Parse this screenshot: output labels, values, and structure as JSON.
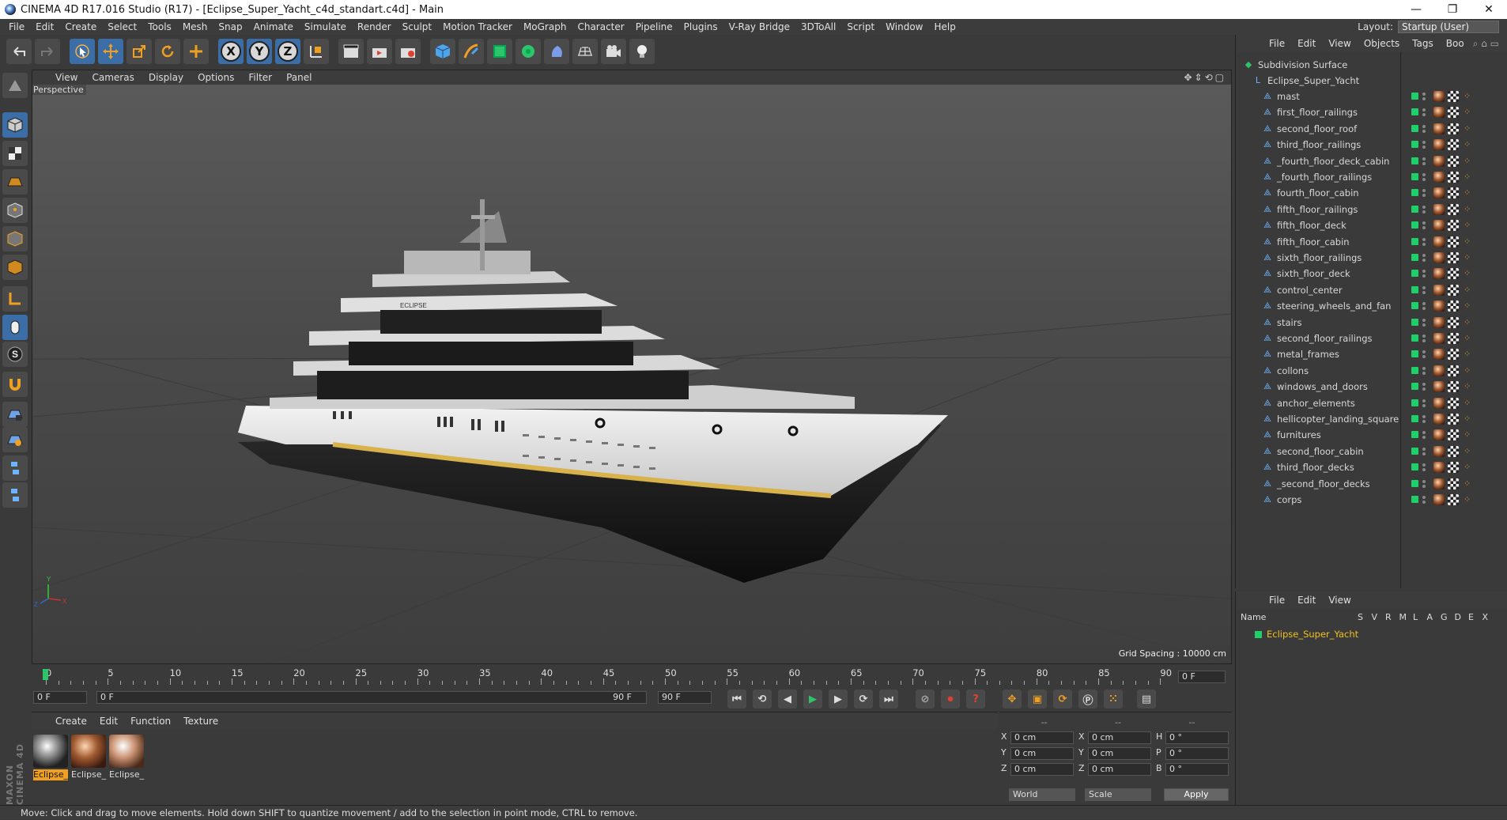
{
  "window": {
    "title": "CINEMA 4D R17.016 Studio (R17) - [Eclipse_Super_Yacht_c4d_standart.c4d] - Main",
    "minimize": "—",
    "restore": "❐",
    "close": "✕"
  },
  "menu": [
    "File",
    "Edit",
    "Create",
    "Select",
    "Tools",
    "Mesh",
    "Snap",
    "Animate",
    "Simulate",
    "Render",
    "Sculpt",
    "Motion Tracker",
    "MoGraph",
    "Character",
    "Pipeline",
    "Plugins",
    "V-Ray Bridge",
    "3DToAll",
    "Script",
    "Window",
    "Help"
  ],
  "layout": {
    "label": "Layout:",
    "value": "Startup (User)"
  },
  "toolbar": {
    "x_axis": "X",
    "y_axis": "Y",
    "z_axis": "Z"
  },
  "viewport": {
    "menu": [
      "View",
      "Cameras",
      "Display",
      "Options",
      "Filter",
      "Panel"
    ],
    "label": "Perspective",
    "grid_spacing": "Grid Spacing : 10000 cm",
    "yacht_name": "ECLIPSE",
    "axis_x": "X",
    "axis_y": "Y",
    "axis_z": "Z"
  },
  "timeline": {
    "ticks": [
      "0",
      "5",
      "10",
      "15",
      "20",
      "25",
      "30",
      "35",
      "40",
      "45",
      "50",
      "55",
      "60",
      "65",
      "70",
      "75",
      "80",
      "85",
      "90"
    ],
    "current_frame": "0 F",
    "start_field": "0 F",
    "range_start": "0 F",
    "range_end": "90 F",
    "end_field": "90 F",
    "frame_display": "0 F"
  },
  "objects_panel": {
    "menu": [
      "File",
      "Edit",
      "View",
      "Objects",
      "Tags",
      "Boo"
    ],
    "root": "Subdivision Surface",
    "group": "Eclipse_Super_Yacht",
    "items": [
      "mast",
      "first_floor_railings",
      "second_floor_roof",
      "third_floor_railings",
      "_fourth_floor_deck_cabin",
      "_fourth_floor_railings",
      "fourth_floor_cabin",
      "fifth_floor_railings",
      "fifth_floor_deck",
      "fifth_floor_cabin",
      "sixth_floor_railings",
      "sixth_floor_deck",
      "control_center",
      "steering_wheels_and_fan",
      "stairs",
      "second_floor_railings",
      "metal_frames",
      "collons",
      "windows_and_doors",
      "anchor_elements",
      "hellicopter_landing_square",
      "furnitures",
      "second_floor_cabin",
      "third_floor_decks",
      "_second_floor_decks",
      "corps"
    ]
  },
  "layers_panel": {
    "menu": [
      "File",
      "Edit",
      "View"
    ],
    "header_name": "Name",
    "columns": [
      "S",
      "V",
      "R",
      "M",
      "L",
      "A",
      "G",
      "D",
      "E",
      "X"
    ],
    "layer": "Eclipse_Super_Yacht",
    "layer_color": "#1fcf6a"
  },
  "materials": {
    "menu": [
      "Create",
      "Edit",
      "Function",
      "Texture"
    ],
    "items": [
      "Eclipse_",
      "Eclipse_",
      "Eclipse_"
    ]
  },
  "brand": "MAXON CINEMA 4D",
  "attributes": {
    "header": [
      "--",
      "--",
      "--"
    ],
    "rows": [
      {
        "a": "X",
        "av": "0 cm",
        "b": "X",
        "bv": "0 cm",
        "c": "H",
        "cv": "0 °"
      },
      {
        "a": "Y",
        "av": "0 cm",
        "b": "Y",
        "bv": "0 cm",
        "c": "P",
        "cv": "0 °"
      },
      {
        "a": "Z",
        "av": "0 cm",
        "b": "Z",
        "bv": "0 cm",
        "c": "B",
        "cv": "0 °"
      }
    ],
    "coord_mode": "World",
    "size_mode": "Scale",
    "apply": "Apply"
  },
  "status": "Move: Click and drag to move elements. Hold down SHIFT to quantize movement / add to the selection in point mode, CTRL to remove.",
  "colors": {
    "accent": "#3b6da6",
    "active_material": "#f0a020",
    "green_tag": "#1fcf6a"
  }
}
